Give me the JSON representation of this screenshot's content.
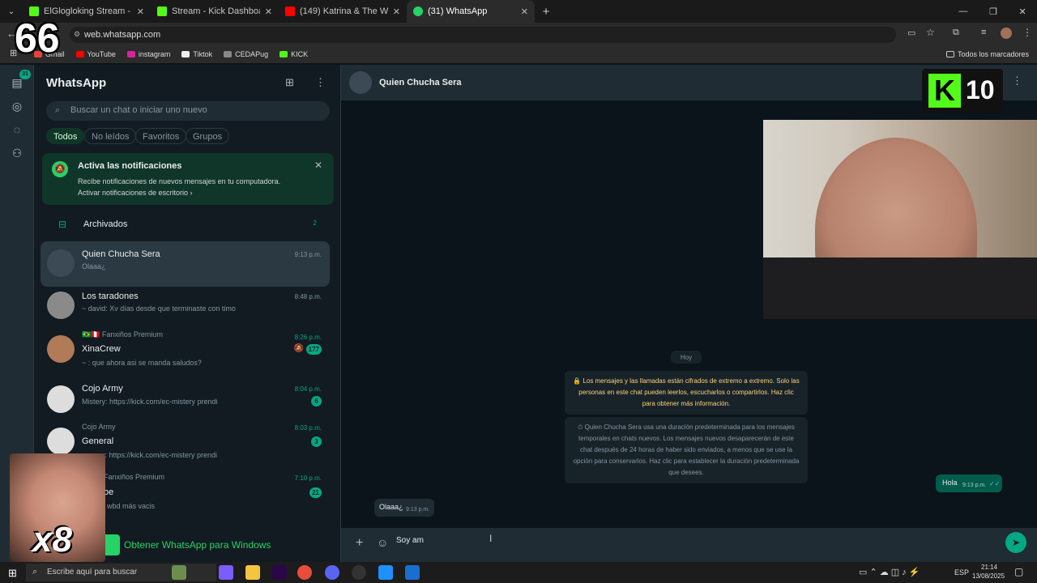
{
  "browser": {
    "tabs": [
      {
        "title": "ElGlogloking Stream - Watch Li",
        "color": "#53fc18"
      },
      {
        "title": "Stream - Kick Dashboard",
        "color": "#53fc18"
      },
      {
        "title": "(149) Katrina & The Waves - W",
        "color": "#ff0000"
      },
      {
        "title": "(31) WhatsApp",
        "color": "#25d366"
      }
    ],
    "url": "web.whatsapp.com",
    "bookmarks": [
      "Gmail",
      "YouTube",
      "instagram",
      "Tiktok",
      "CEDAPug",
      "KICK"
    ],
    "all_bookmarks": "Todos los marcadores"
  },
  "overlay": {
    "counter": "66",
    "kick_count": "10",
    "kick_logo": "K",
    "combo": "x8"
  },
  "rail": {
    "badge": "31"
  },
  "sidebar": {
    "title": "WhatsApp",
    "search_placeholder": "Buscar un chat o iniciar uno nuevo",
    "filters": [
      "Todos",
      "No leídos",
      "Favoritos",
      "Grupos"
    ],
    "notif_title": "Activa las notificaciones",
    "notif_text": "Recibe notificaciones de nuevos mensajes en tu computadora.",
    "notif_link": "Activar notificaciones de escritorio ›",
    "archived_label": "Archivados",
    "archived_count": "2",
    "get_app": "Obtener WhatsApp para Windows",
    "chats": [
      {
        "name": "Quien Chucha Sera",
        "msg": "Olaaa¿",
        "time": "9:13 p.m.",
        "badge": "",
        "pre": ""
      },
      {
        "name": "Los taradones",
        "msg": "~ david: Xv días desde que terminaste con timo",
        "time": "8:48 p.m.",
        "badge": "",
        "pre": ""
      },
      {
        "name": "XinaCrew",
        "msg": "~ : que ahora asi se manda saludos?",
        "time": "8:26 p.m.",
        "badge": "177",
        "pre": "🇧🇷🇵🇪 Fanxiños Premium"
      },
      {
        "name": "Cojo Army",
        "msg": "Mistery: https://kick.com/ec-mistery prendi",
        "time": "8:04 p.m.",
        "badge": "6",
        "pre": ""
      },
      {
        "name": "General",
        "msg": "y: https://kick.com/ec-mistery prendi",
        "time": "8:03 p.m.",
        "badge": "3",
        "pre": "Cojo Army"
      },
      {
        "name": "oe",
        "msg": "wbd más vacis",
        "time": "7:10 p.m.",
        "badge": "21",
        "pre": "Fanxiños Premium"
      }
    ]
  },
  "chat": {
    "contact": "Quien Chucha Sera",
    "day": "Hoy",
    "encryption": "🔒 Los mensajes y las llamadas están cifrados de extremo a extremo. Solo las personas en este chat pueden leerlos, escucharlos o compartirlos. Haz clic para obtener más información.",
    "disappearing": "⏲ Quien Chucha Sera usa una duración predeterminada para los mensajes temporales en chats nuevos. Los mensajes nuevos desaparecerán de este chat después de 24 horas de haber sido enviados, a menos que se use la opción para conservarlos. Haz clic para establecer la duración predeterminada que desees.",
    "out_msg": {
      "text": "Hola",
      "time": "9:13 p.m."
    },
    "in_msg": {
      "text": "Olaaa¿",
      "time": "9:13 p.m."
    },
    "compose_text": "Soy am"
  },
  "taskbar": {
    "search_placeholder": "Escribe aquí para buscar",
    "lang": "ESP",
    "time": "21:14",
    "date": "13/08/2025"
  },
  "colors": {
    "accent": "#00a884",
    "kick": "#53fc18"
  }
}
